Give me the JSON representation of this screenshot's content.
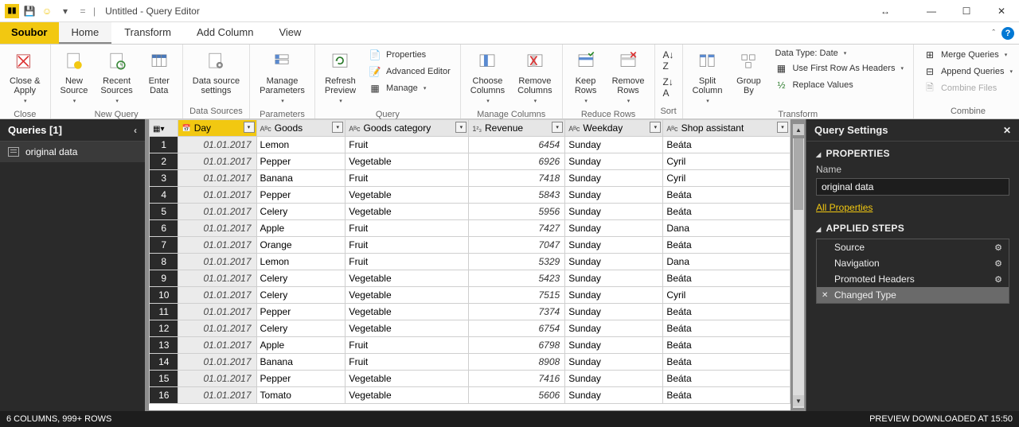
{
  "window": {
    "title": "Untitled - Query Editor"
  },
  "menutabs": {
    "file": "Soubor",
    "home": "Home",
    "transform": "Transform",
    "addcol": "Add Column",
    "view": "View"
  },
  "ribbon": {
    "close_apply": "Close &\nApply",
    "group_close": "Close",
    "new_source": "New\nSource",
    "recent_sources": "Recent\nSources",
    "enter_data": "Enter\nData",
    "group_newquery": "New Query",
    "ds_settings": "Data source\nsettings",
    "group_ds": "Data Sources",
    "manage_params": "Manage\nParameters",
    "group_params": "Parameters",
    "refresh": "Refresh\nPreview",
    "properties": "Properties",
    "adv_editor": "Advanced Editor",
    "manage": "Manage",
    "group_query": "Query",
    "choose_cols": "Choose\nColumns",
    "remove_cols": "Remove\nColumns",
    "group_mc": "Manage Columns",
    "keep_rows": "Keep\nRows",
    "remove_rows": "Remove\nRows",
    "group_rr": "Reduce Rows",
    "group_sort": "Sort",
    "split_col": "Split\nColumn",
    "group_by": "Group\nBy",
    "datatype": "Data Type: Date",
    "first_row": "Use First Row As Headers",
    "replace": "Replace Values",
    "group_transform": "Transform",
    "merge": "Merge Queries",
    "append": "Append Queries",
    "combine_files": "Combine Files",
    "group_combine": "Combine"
  },
  "queries": {
    "header": "Queries [1]",
    "item1": "original data"
  },
  "columns": {
    "day": "Day",
    "goods": "Goods",
    "goods_cat": "Goods category",
    "revenue": "Revenue",
    "weekday": "Weekday",
    "assistant": "Shop assistant"
  },
  "rows": [
    {
      "n": "1",
      "day": "01.01.2017",
      "goods": "Lemon",
      "cat": "Fruit",
      "rev": "6454",
      "wd": "Sunday",
      "sa": "Beáta"
    },
    {
      "n": "2",
      "day": "01.01.2017",
      "goods": "Pepper",
      "cat": "Vegetable",
      "rev": "6926",
      "wd": "Sunday",
      "sa": "Cyril"
    },
    {
      "n": "3",
      "day": "01.01.2017",
      "goods": "Banana",
      "cat": "Fruit",
      "rev": "7418",
      "wd": "Sunday",
      "sa": "Cyril"
    },
    {
      "n": "4",
      "day": "01.01.2017",
      "goods": "Pepper",
      "cat": "Vegetable",
      "rev": "5843",
      "wd": "Sunday",
      "sa": "Beáta"
    },
    {
      "n": "5",
      "day": "01.01.2017",
      "goods": "Celery",
      "cat": "Vegetable",
      "rev": "5956",
      "wd": "Sunday",
      "sa": "Beáta"
    },
    {
      "n": "6",
      "day": "01.01.2017",
      "goods": "Apple",
      "cat": "Fruit",
      "rev": "7427",
      "wd": "Sunday",
      "sa": "Dana"
    },
    {
      "n": "7",
      "day": "01.01.2017",
      "goods": "Orange",
      "cat": "Fruit",
      "rev": "7047",
      "wd": "Sunday",
      "sa": "Beáta"
    },
    {
      "n": "8",
      "day": "01.01.2017",
      "goods": "Lemon",
      "cat": "Fruit",
      "rev": "5329",
      "wd": "Sunday",
      "sa": "Dana"
    },
    {
      "n": "9",
      "day": "01.01.2017",
      "goods": "Celery",
      "cat": "Vegetable",
      "rev": "5423",
      "wd": "Sunday",
      "sa": "Beáta"
    },
    {
      "n": "10",
      "day": "01.01.2017",
      "goods": "Celery",
      "cat": "Vegetable",
      "rev": "7515",
      "wd": "Sunday",
      "sa": "Cyril"
    },
    {
      "n": "11",
      "day": "01.01.2017",
      "goods": "Pepper",
      "cat": "Vegetable",
      "rev": "7374",
      "wd": "Sunday",
      "sa": "Beáta"
    },
    {
      "n": "12",
      "day": "01.01.2017",
      "goods": "Celery",
      "cat": "Vegetable",
      "rev": "6754",
      "wd": "Sunday",
      "sa": "Beáta"
    },
    {
      "n": "13",
      "day": "01.01.2017",
      "goods": "Apple",
      "cat": "Fruit",
      "rev": "6798",
      "wd": "Sunday",
      "sa": "Beáta"
    },
    {
      "n": "14",
      "day": "01.01.2017",
      "goods": "Banana",
      "cat": "Fruit",
      "rev": "8908",
      "wd": "Sunday",
      "sa": "Beáta"
    },
    {
      "n": "15",
      "day": "01.01.2017",
      "goods": "Pepper",
      "cat": "Vegetable",
      "rev": "7416",
      "wd": "Sunday",
      "sa": "Beáta"
    },
    {
      "n": "16",
      "day": "01.01.2017",
      "goods": "Tomato",
      "cat": "Vegetable",
      "rev": "5606",
      "wd": "Sunday",
      "sa": "Beáta"
    }
  ],
  "settings": {
    "title": "Query Settings",
    "props": "PROPERTIES",
    "name_label": "Name",
    "name_value": "original data",
    "all_props": "All Properties",
    "steps_title": "APPLIED STEPS",
    "steps": [
      "Source",
      "Navigation",
      "Promoted Headers",
      "Changed Type"
    ]
  },
  "status": {
    "left": "6 COLUMNS, 999+ ROWS",
    "right": "PREVIEW DOWNLOADED AT 15:50"
  }
}
